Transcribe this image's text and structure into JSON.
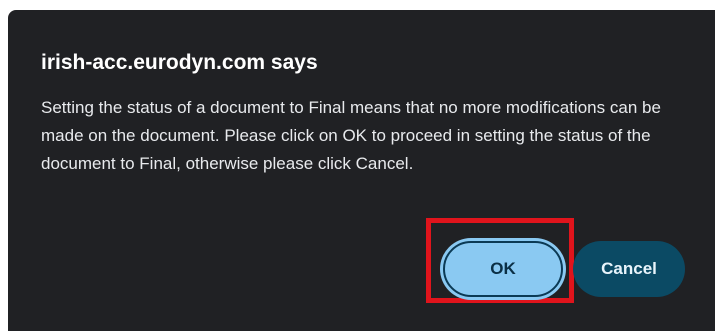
{
  "dialog": {
    "title": "irish-acc.eurodyn.com says",
    "message": "Setting the status of a document to Final means that no more modifications can be made on the document. Please click on OK to proceed in setting the status of the document to Final, otherwise please click Cancel.",
    "ok_label": "OK",
    "cancel_label": "Cancel"
  },
  "colors": {
    "dialog_background": "#202124",
    "ok_button": "#8ac9f2",
    "cancel_button": "#0b4a64",
    "highlight_border": "#e0141c"
  }
}
